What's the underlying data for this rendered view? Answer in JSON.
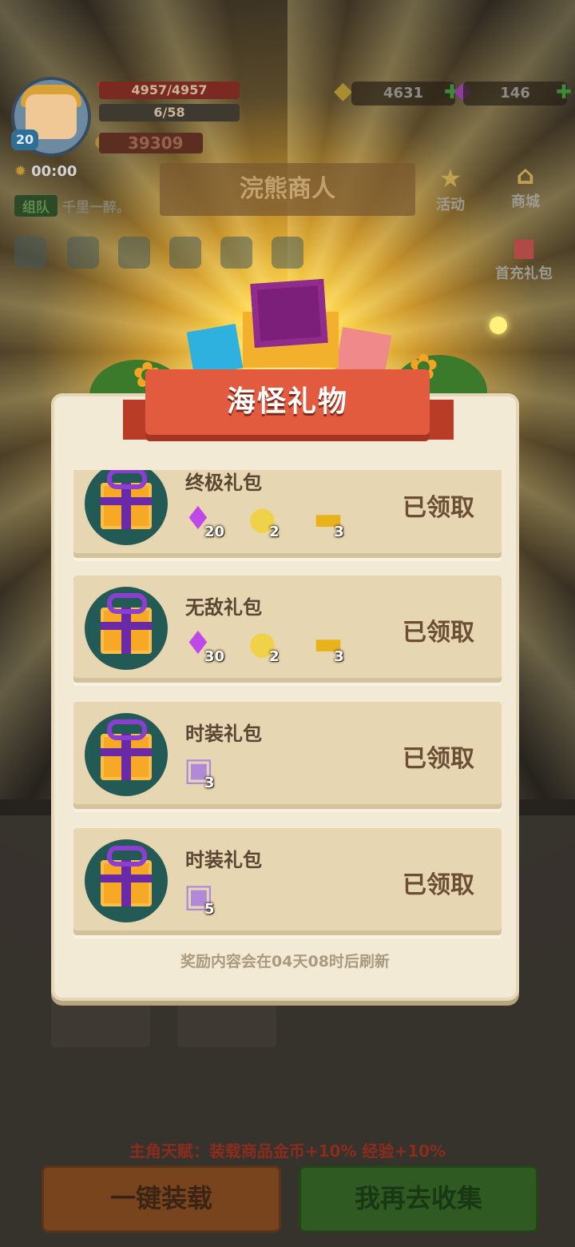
{
  "hud": {
    "level": "20",
    "hp": "4957/4957",
    "xp": "6/58",
    "gold": "39309",
    "timer": "00:00",
    "team_tag": "组队",
    "team_name": "千里一醉。",
    "coins": "4631",
    "gems": "146",
    "store_badge": "STORE"
  },
  "background": {
    "title": "浣熊商人",
    "side_buttons": {
      "activity": "活动",
      "shop": "商城",
      "first_charge": "首充礼包"
    }
  },
  "modal": {
    "title": "海怪礼物",
    "items": [
      {
        "name": "终极礼包",
        "rewards": [
          {
            "icon": "gem-icon",
            "count": "20"
          },
          {
            "icon": "potion-icon",
            "count": "2"
          },
          {
            "icon": "ticket-icon",
            "count": "3"
          }
        ],
        "status": "已领取"
      },
      {
        "name": "无敌礼包",
        "rewards": [
          {
            "icon": "gem-icon",
            "count": "30"
          },
          {
            "icon": "potion-icon",
            "count": "2"
          },
          {
            "icon": "ticket-icon",
            "count": "3"
          }
        ],
        "status": "已领取"
      },
      {
        "name": "时装礼包",
        "rewards": [
          {
            "icon": "costume-card-icon",
            "count": "3"
          }
        ],
        "status": "已领取"
      },
      {
        "name": "时装礼包",
        "rewards": [
          {
            "icon": "costume-card-icon",
            "count": "5"
          }
        ],
        "status": "已领取"
      }
    ],
    "refresh_note": "奖励内容会在04天08时后刷新"
  },
  "footer": {
    "talent": "主角天赋：装载商品金币+10% 经验+10%",
    "load_button": "一键装载",
    "collect_button": "我再去收集"
  },
  "colors": {
    "ribbon": "#e25b3e",
    "panel": "#f3ead5",
    "item_bg": "#e6d7b2",
    "status_text": "#6b4e34"
  }
}
